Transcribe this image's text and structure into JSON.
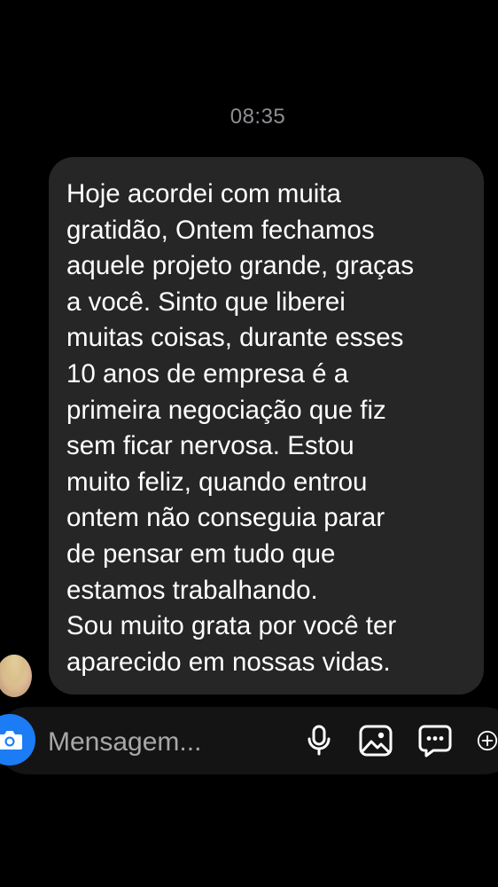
{
  "conversation": {
    "timestamp": "08:35",
    "message": {
      "text": "Hoje acordei com muita\ngratidão, Ontem fechamos\naquele projeto grande, graças\na você. Sinto que liberei\nmuitas coisas, durante esses\n10 anos de empresa é a\nprimeira negociação que fiz\nsem ficar nervosa. Estou\nmuito feliz, quando entrou\nontem não conseguia parar\nde pensar em tudo que\nestamos trabalhando.\nSou muito grata por você ter\naparecido em nossas vidas."
    }
  },
  "composer": {
    "placeholder": "Mensagem...",
    "value": ""
  },
  "icons": {
    "camera": "camera-icon",
    "microphone": "microphone-icon",
    "gallery": "gallery-icon",
    "sticker": "chat-bubble-icon",
    "add": "plus-circle-icon"
  },
  "colors": {
    "background": "#000000",
    "bubble": "#262626",
    "accent": "#1b7cf5",
    "timestamp": "#8e8e93"
  }
}
